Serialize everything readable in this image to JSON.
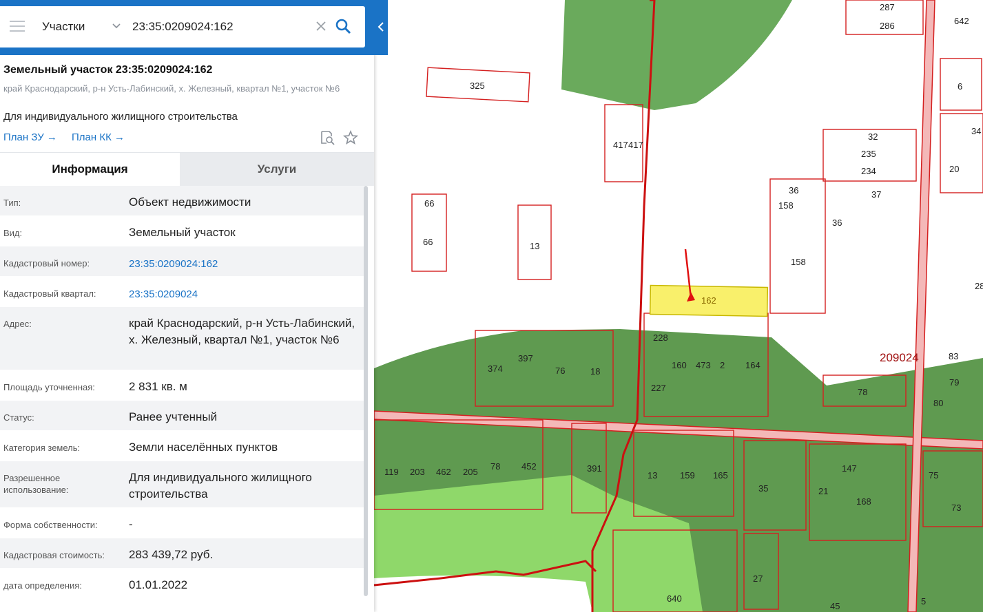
{
  "search": {
    "category": "Участки",
    "query": "23:35:0209024:162"
  },
  "object": {
    "title": "Земельный участок 23:35:0209024:162",
    "address": "край Краснодарский, р-н Усть-Лабинский, х. Железный, квартал №1, участок №6",
    "purpose": "Для индивидуального жилищного строительства",
    "plan_zu": "План ЗУ →",
    "plan_kk": "План КК →"
  },
  "tabs": {
    "info": "Информация",
    "services": "Услуги"
  },
  "info_rows": [
    {
      "label": "Тип:",
      "value": "Объект недвижимости"
    },
    {
      "label": "Вид:",
      "value": "Земельный участок"
    },
    {
      "label": "Кадастровый номер:",
      "value": "23:35:0209024:162"
    },
    {
      "label": "Кадастровый квартал:",
      "value": "23:35:0209024"
    },
    {
      "label": "Адрес:",
      "value": "край Краснодарский, р-н Усть-Лабинский, х. Железный, квартал №1, участок №6"
    },
    {
      "label": "Площадь уточненная:",
      "value": "2 831 кв. м"
    },
    {
      "label": "Статус:",
      "value": "Ранее учтенный"
    },
    {
      "label": "Категория земель:",
      "value": "Земли населённых пунктов"
    },
    {
      "label": "Разрешенное использование:",
      "value": "Для индивидуального жилищного строительства"
    },
    {
      "label": "Форма собственности:",
      "value": "-"
    },
    {
      "label": "Кадастровая стоимость:",
      "value": "283 439,72 руб."
    },
    {
      "label": "дата определения:",
      "value": "01.01.2022"
    }
  ],
  "map": {
    "quarter_label": "209024",
    "selected_parcel": "162",
    "parcel_labels": [
      "287",
      "286",
      "642",
      "6",
      "325",
      "32",
      "235",
      "234",
      "37",
      "36",
      "158",
      "36",
      "34",
      "20",
      "417",
      "417",
      "66",
      "66",
      "13",
      "158",
      "162",
      "28",
      "228",
      "160",
      "473",
      "2",
      "164",
      "374",
      "397",
      "76",
      "18",
      "227",
      "209024",
      "83",
      "79",
      "78",
      "80",
      "119",
      "203",
      "462",
      "205",
      "78",
      "452",
      "391",
      "13",
      "159",
      "165",
      "35",
      "21",
      "147",
      "168",
      "75",
      "73",
      "27",
      "640",
      "45",
      "5"
    ]
  },
  "colors": {
    "accent": "#1a73c6",
    "parcel_border": "#d42020",
    "selected_fill": "#f9f06b",
    "forest": "#5c9c4e",
    "grass": "#8fd86a",
    "road": "#f4b8b8"
  }
}
